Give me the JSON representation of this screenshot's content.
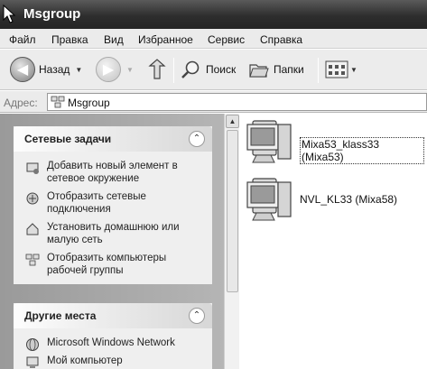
{
  "window": {
    "title": "Msgroup"
  },
  "menu": [
    "Файл",
    "Правка",
    "Вид",
    "Избранное",
    "Сервис",
    "Справка"
  ],
  "toolbar": {
    "back_label": "Назад",
    "search_label": "Поиск",
    "folders_label": "Папки"
  },
  "address": {
    "label": "Адрес:",
    "value": "Msgroup"
  },
  "network_tasks": {
    "title": "Сетевые задачи",
    "items": [
      "Добавить новый элемент в сетевое окружение",
      "Отобразить сетевые подключения",
      "Установить домашнюю или малую сеть",
      "Отобразить компьютеры рабочей группы"
    ]
  },
  "other_places": {
    "title": "Другие места",
    "items": [
      "Microsoft Windows Network",
      "Мой компьютер"
    ]
  },
  "computers": [
    {
      "name": "Mixa53_klass33 (Mixa53)",
      "selected": true
    },
    {
      "name": "NVL_KL33 (Mixa58)",
      "selected": false
    }
  ]
}
